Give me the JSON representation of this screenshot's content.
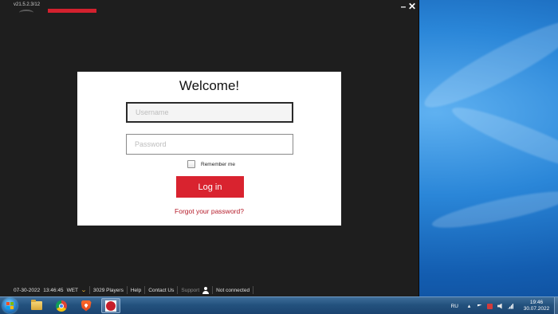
{
  "app": {
    "version": "v21.5.2.3/12",
    "controls": {
      "minimize": "–",
      "close": "✕"
    }
  },
  "login": {
    "title": "Welcome!",
    "username_placeholder": "Username",
    "username_value": "",
    "password_placeholder": "Password",
    "password_value": "",
    "remember_label": "Remember me",
    "remember_checked": false,
    "login_button": "Log in",
    "forgot_link": "Forgot your password?"
  },
  "status_bar": {
    "date": "07-30-2022",
    "time": "13:46:45",
    "timezone": "WET",
    "players": "3029 Players",
    "help": "Help",
    "contact": "Contact Us",
    "support": "Support",
    "connection": "Not connected"
  },
  "taskbar": {
    "items": [
      {
        "name": "start",
        "icon": "windows-logo-icon"
      },
      {
        "name": "explorer",
        "icon": "folder-icon"
      },
      {
        "name": "chrome",
        "icon": "chrome-icon"
      },
      {
        "name": "brave",
        "icon": "brave-icon"
      },
      {
        "name": "poker-app",
        "icon": "app-icon",
        "active": true
      }
    ],
    "tray": {
      "language": "RU",
      "clock_time": "19:46",
      "clock_date": "30.07.2022"
    }
  },
  "colors": {
    "accent": "#d9232f",
    "app_background": "#1e1e1e",
    "link": "#b51c2a",
    "desktop_blue": "#1565b8"
  }
}
